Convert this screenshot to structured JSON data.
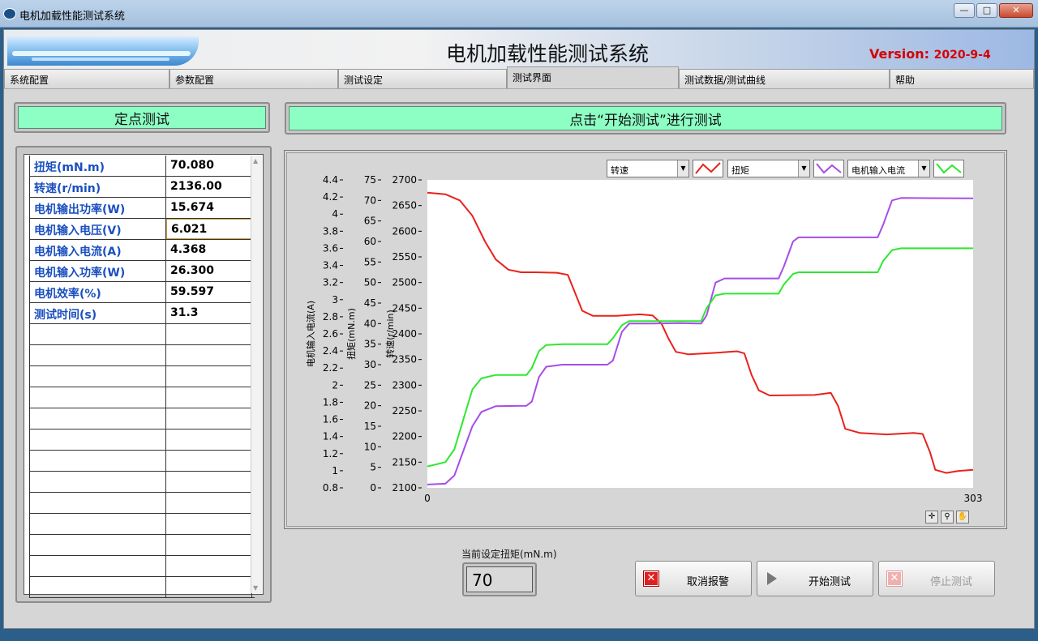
{
  "window": {
    "title": "电机加载性能测试系统",
    "min": "—",
    "max": "□",
    "close": "✕"
  },
  "banner": {
    "title": "电机加载性能测试系统",
    "version_label": "Version:",
    "version_date": "2020-9-4"
  },
  "tabs": [
    {
      "label": "系统配置"
    },
    {
      "label": "参数配置"
    },
    {
      "label": "测试设定"
    },
    {
      "label": "测试界面"
    },
    {
      "label": "测试数据/测试曲线"
    },
    {
      "label": "帮助"
    }
  ],
  "left_header": "定点测试",
  "right_header": "点击“开始测试”进行测试",
  "table": {
    "rows": [
      {
        "name": "扭矩(mN.m)",
        "value": "70.080"
      },
      {
        "name": "转速(r/min)",
        "value": "2136.00"
      },
      {
        "name": "电机输出功率(W)",
        "value": "15.674"
      },
      {
        "name": "电机输入电压(V)",
        "value": "6.021"
      },
      {
        "name": "电机输入电流(A)",
        "value": "4.368"
      },
      {
        "name": "电机输入功率(W)",
        "value": "26.300"
      },
      {
        "name": "电机效率(%)",
        "value": "59.597"
      },
      {
        "name": "测试时间(s)",
        "value": "31.3"
      }
    ],
    "empty_rows": 13
  },
  "legend": [
    {
      "label": "转速",
      "color": "#e8221c"
    },
    {
      "label": "扭矩",
      "color": "#a64de8"
    },
    {
      "label": "电机输入电流",
      "color": "#2ee82e"
    }
  ],
  "setpoint": {
    "label": "当前设定扭矩(mN.m)",
    "value": "70"
  },
  "buttons": {
    "cancel_alarm": "取消报警",
    "start_test": "开始测试",
    "stop_test": "停止测试"
  },
  "chart_data": {
    "type": "line",
    "x_range": [
      0,
      303
    ],
    "x_ticks": [
      "0",
      "303"
    ],
    "axes": [
      {
        "label": "转速(r/min)",
        "range": [
          2100,
          2700
        ],
        "ticks": [
          "2100",
          "2150",
          "2200",
          "2250",
          "2300",
          "2350",
          "2400",
          "2450",
          "2500",
          "2550",
          "2600",
          "2650",
          "2700"
        ]
      },
      {
        "label": "扭矩(mN.m)",
        "range": [
          0,
          75
        ],
        "ticks": [
          "0",
          "5",
          "10",
          "15",
          "20",
          "25",
          "30",
          "35",
          "40",
          "45",
          "50",
          "55",
          "60",
          "65",
          "70",
          "75"
        ]
      },
      {
        "label": "电机输入电流(A)",
        "range": [
          0.8,
          4.4
        ],
        "ticks": [
          "0.8",
          "1",
          "1.2",
          "1.4",
          "1.6",
          "1.8",
          "2",
          "2.2",
          "2.4",
          "2.6",
          "2.8",
          "3",
          "3.2",
          "3.4",
          "3.6",
          "3.8",
          "4",
          "4.2",
          "4.4"
        ]
      }
    ],
    "series": [
      {
        "name": "转速",
        "axis": 0,
        "color": "#e8221c",
        "points": [
          [
            0,
            2675
          ],
          [
            10,
            2672
          ],
          [
            18,
            2660
          ],
          [
            25,
            2630
          ],
          [
            32,
            2580
          ],
          [
            38,
            2545
          ],
          [
            45,
            2525
          ],
          [
            52,
            2520
          ],
          [
            60,
            2520
          ],
          [
            72,
            2519
          ],
          [
            78,
            2515
          ],
          [
            82,
            2480
          ],
          [
            86,
            2445
          ],
          [
            92,
            2435
          ],
          [
            105,
            2435
          ],
          [
            118,
            2438
          ],
          [
            125,
            2436
          ],
          [
            130,
            2420
          ],
          [
            134,
            2390
          ],
          [
            138,
            2365
          ],
          [
            145,
            2360
          ],
          [
            160,
            2363
          ],
          [
            172,
            2366
          ],
          [
            176,
            2362
          ],
          [
            180,
            2320
          ],
          [
            184,
            2290
          ],
          [
            190,
            2280
          ],
          [
            215,
            2281
          ],
          [
            224,
            2285
          ],
          [
            228,
            2260
          ],
          [
            232,
            2215
          ],
          [
            240,
            2207
          ],
          [
            255,
            2204
          ],
          [
            270,
            2207
          ],
          [
            275,
            2205
          ],
          [
            279,
            2170
          ],
          [
            282,
            2135
          ],
          [
            288,
            2129
          ],
          [
            295,
            2133
          ],
          [
            303,
            2135
          ]
        ]
      },
      {
        "name": "扭矩",
        "axis": 1,
        "color": "#a64de8",
        "points": [
          [
            0,
            0.8
          ],
          [
            10,
            1
          ],
          [
            15,
            3
          ],
          [
            20,
            9
          ],
          [
            25,
            15
          ],
          [
            30,
            18.5
          ],
          [
            38,
            19.9
          ],
          [
            55,
            20
          ],
          [
            58,
            21
          ],
          [
            62,
            27
          ],
          [
            66,
            29.5
          ],
          [
            75,
            30
          ],
          [
            100,
            30
          ],
          [
            103,
            31
          ],
          [
            108,
            38
          ],
          [
            112,
            40
          ],
          [
            125,
            40
          ],
          [
            140,
            40.1
          ],
          [
            152,
            40
          ],
          [
            155,
            42
          ],
          [
            160,
            50
          ],
          [
            165,
            51
          ],
          [
            185,
            51
          ],
          [
            195,
            51
          ],
          [
            198,
            54
          ],
          [
            203,
            60
          ],
          [
            206,
            61
          ],
          [
            230,
            61
          ],
          [
            250,
            61
          ],
          [
            253,
            64
          ],
          [
            258,
            70
          ],
          [
            263,
            70.6
          ],
          [
            303,
            70.5
          ]
        ]
      },
      {
        "name": "电机输入电流",
        "axis": 2,
        "color": "#2ee82e",
        "points": [
          [
            0,
            1.05
          ],
          [
            10,
            1.1
          ],
          [
            15,
            1.25
          ],
          [
            20,
            1.6
          ],
          [
            25,
            1.95
          ],
          [
            30,
            2.08
          ],
          [
            38,
            2.12
          ],
          [
            55,
            2.12
          ],
          [
            58,
            2.2
          ],
          [
            62,
            2.4
          ],
          [
            66,
            2.47
          ],
          [
            75,
            2.48
          ],
          [
            100,
            2.48
          ],
          [
            103,
            2.55
          ],
          [
            108,
            2.7
          ],
          [
            112,
            2.75
          ],
          [
            125,
            2.75
          ],
          [
            140,
            2.75
          ],
          [
            152,
            2.75
          ],
          [
            155,
            2.9
          ],
          [
            160,
            3.05
          ],
          [
            165,
            3.07
          ],
          [
            185,
            3.07
          ],
          [
            195,
            3.07
          ],
          [
            198,
            3.18
          ],
          [
            203,
            3.3
          ],
          [
            206,
            3.32
          ],
          [
            230,
            3.32
          ],
          [
            250,
            3.32
          ],
          [
            253,
            3.45
          ],
          [
            258,
            3.58
          ],
          [
            263,
            3.6
          ],
          [
            303,
            3.6
          ]
        ]
      }
    ]
  }
}
